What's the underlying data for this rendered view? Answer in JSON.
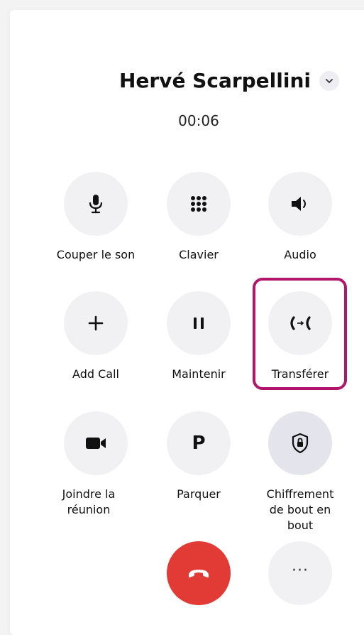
{
  "call": {
    "caller_name": "Hervé Scarpellini",
    "timer": "00:06"
  },
  "controls": [
    {
      "id": "mute",
      "label": "Couper le son",
      "icon": "microphone-icon"
    },
    {
      "id": "keypad",
      "label": "Clavier",
      "icon": "keypad-icon"
    },
    {
      "id": "audio",
      "label": "Audio",
      "icon": "speaker-icon"
    },
    {
      "id": "add-call",
      "label": "Add Call",
      "icon": "plus-icon"
    },
    {
      "id": "hold",
      "label": "Maintenir",
      "icon": "pause-icon"
    },
    {
      "id": "transfer",
      "label": "Transférer",
      "icon": "transfer-call-icon",
      "highlighted": true
    },
    {
      "id": "join-meeting",
      "label": "Joindre la réunion",
      "icon": "video-camera-icon"
    },
    {
      "id": "park",
      "label": "Parquer",
      "icon": "park-letter-icon",
      "glyph": "P"
    },
    {
      "id": "encryption",
      "label": "Chiffrement de bout en bout",
      "icon": "shield-lock-icon"
    }
  ],
  "bottom": {
    "hangup_icon": "hang-up-icon",
    "more_icon": "more-dots-icon",
    "more_glyph": "···"
  },
  "colors": {
    "hangup": "#e23a34",
    "highlight": "#b3146c",
    "button_bg": "#f1f1f4"
  }
}
